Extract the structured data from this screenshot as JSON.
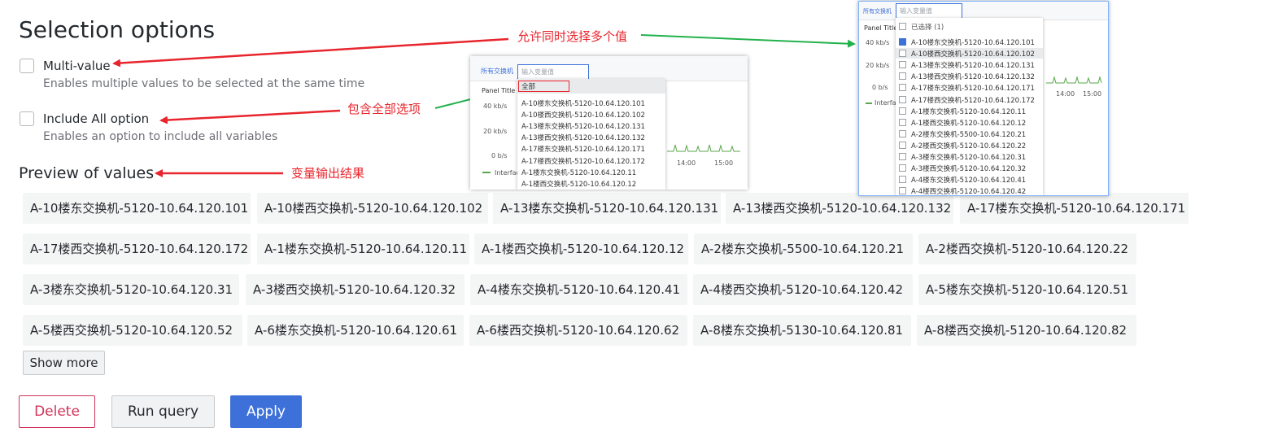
{
  "selection": {
    "title": "Selection options",
    "multi_value": {
      "label": "Multi-value",
      "description": "Enables multiple values to be selected at the same time",
      "checked": false
    },
    "include_all": {
      "label": "Include All option",
      "description": "Enables an option to include all variables",
      "checked": false
    }
  },
  "preview": {
    "title": "Preview of values",
    "values": [
      "A-10楼东交换机-5120-10.64.120.101",
      "A-10楼西交换机-5120-10.64.120.102",
      "A-13楼东交换机-5120-10.64.120.131",
      "A-13楼西交换机-5120-10.64.120.132",
      "A-17楼东交换机-5120-10.64.120.171",
      "A-17楼西交换机-5120-10.64.120.172",
      "A-1楼东交换机-5120-10.64.120.11",
      "A-1楼西交换机-5120-10.64.120.12",
      "A-2楼东交换机-5500-10.64.120.21",
      "A-2楼西交换机-5120-10.64.120.22",
      "A-3楼东交换机-5120-10.64.120.31",
      "A-3楼西交换机-5120-10.64.120.32",
      "A-4楼东交换机-5120-10.64.120.41",
      "A-4楼西交换机-5120-10.64.120.42",
      "A-5楼东交换机-5120-10.64.120.51",
      "A-5楼西交换机-5120-10.64.120.52",
      "A-6楼东交换机-5120-10.64.120.61",
      "A-6楼西交换机-5120-10.64.120.62",
      "A-8楼东交换机-5130-10.64.120.81",
      "A-8楼西交换机-5120-10.64.120.82"
    ],
    "show_more_label": "Show more"
  },
  "actions": {
    "delete": "Delete",
    "run_query": "Run query",
    "apply": "Apply"
  },
  "annotations": {
    "multi": "允许同时选择多个值",
    "include_all": "包含全部选项",
    "preview": "变量输出结果"
  },
  "shot1": {
    "var_label": "所有交换机",
    "input_placeholder": "输入变量值",
    "panel_title": "Panel Title",
    "all_option": "全部",
    "y_ticks": [
      "40 kb/s",
      "20 kb/s",
      "0 b/s"
    ],
    "x_ticks": [
      "14:00",
      "15:00"
    ],
    "legend": "Interfac",
    "options": [
      "A-10楼东交换机-5120-10.64.120.101",
      "A-10楼西交换机-5120-10.64.120.102",
      "A-13楼东交换机-5120-10.64.120.131",
      "A-13楼西交换机-5120-10.64.120.132",
      "A-17楼东交换机-5120-10.64.120.171",
      "A-17楼西交换机-5120-10.64.120.172",
      "A-1楼东交换机-5120-10.64.120.11",
      "A-1楼西交换机-5120-10.64.120.12"
    ]
  },
  "shot2": {
    "var_label": "所有交换机",
    "input_placeholder": "输入变量值",
    "panel_title": "Panel Title",
    "selected_header": "已选择 (1)",
    "y_ticks": [
      "40 kb/s",
      "20 kb/s",
      "0 b/s"
    ],
    "x_ticks": [
      "14:00",
      "15:00"
    ],
    "legend": "Interfac",
    "options": [
      "A-10楼东交换机-5120-10.64.120.101",
      "A-10楼西交换机-5120-10.64.120.102",
      "A-13楼东交换机-5120-10.64.120.131",
      "A-13楼西交换机-5120-10.64.120.132",
      "A-17楼东交换机-5120-10.64.120.171",
      "A-17楼西交换机-5120-10.64.120.172",
      "A-1楼东交换机-5120-10.64.120.11",
      "A-1楼西交换机-5120-10.64.120.12",
      "A-2楼东交换机-5500-10.64.120.21",
      "A-2楼西交换机-5120-10.64.120.22",
      "A-3楼东交换机-5120-10.64.120.31",
      "A-3楼西交换机-5120-10.64.120.32",
      "A-4楼东交换机-5120-10.64.120.41",
      "A-4楼西交换机-5120-10.64.120.42"
    ],
    "checked_index": 0
  },
  "colors": {
    "red": "#e8252d",
    "green": "#22b24c",
    "apply": "#3d71d9",
    "delete": "#d1335a"
  }
}
